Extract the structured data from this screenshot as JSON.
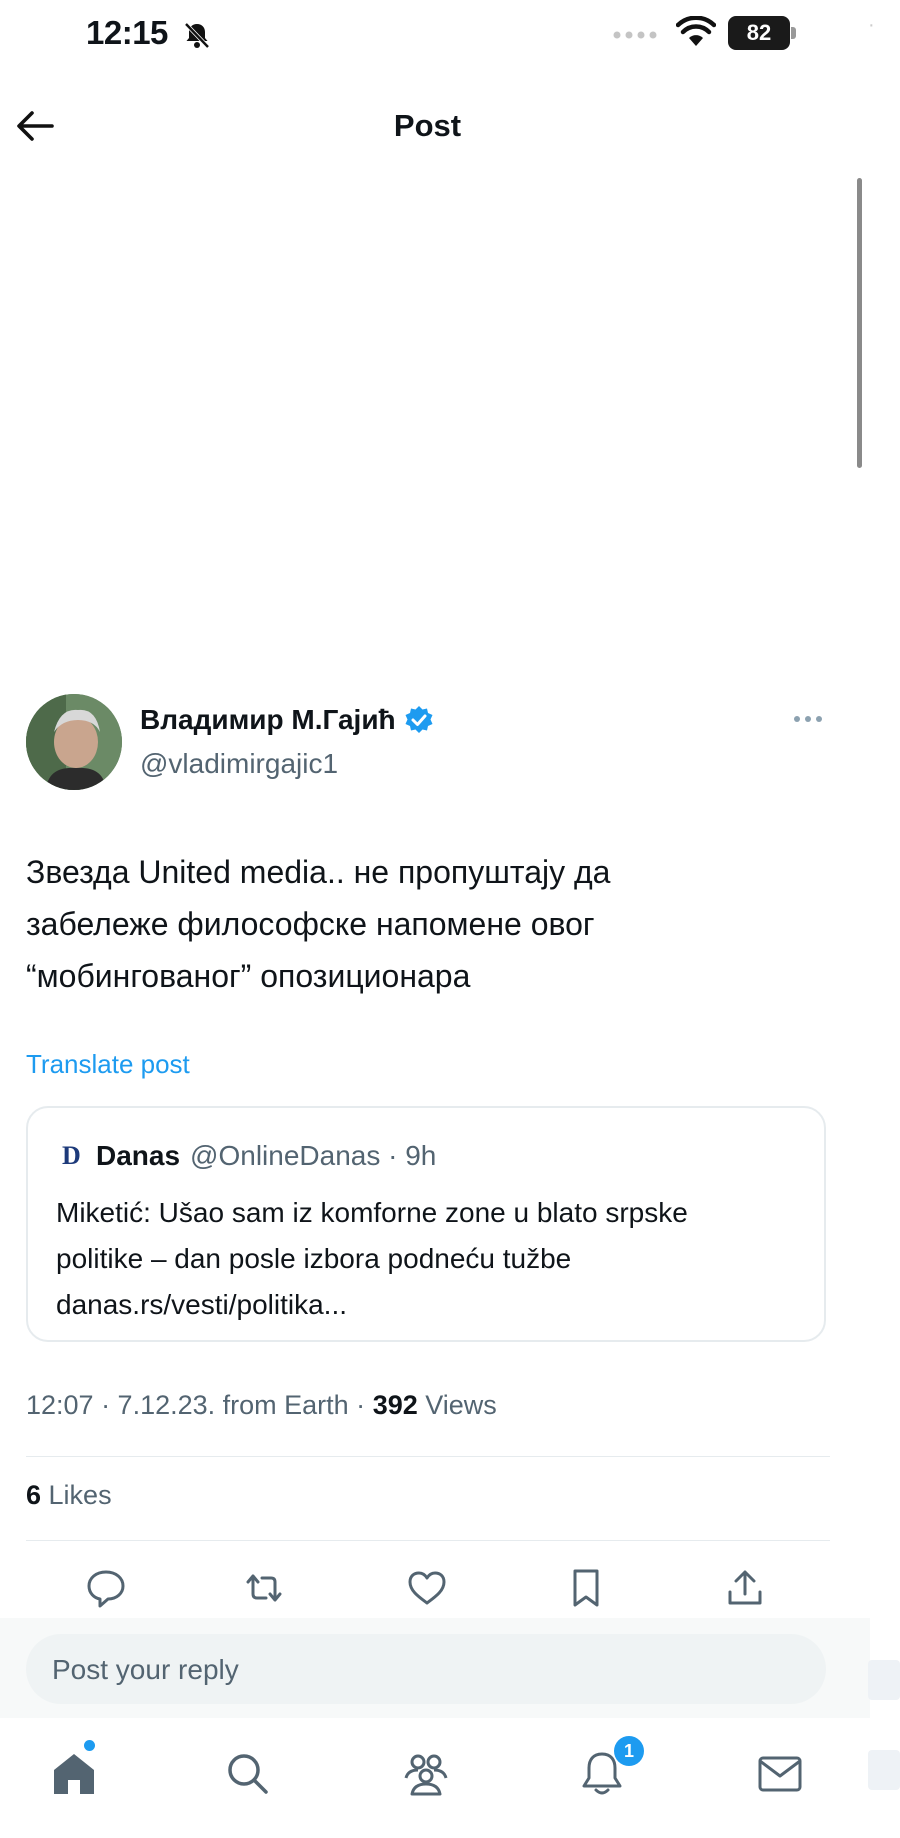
{
  "status_bar": {
    "time": "12:15",
    "battery": "82"
  },
  "header": {
    "title": "Post"
  },
  "post": {
    "author_name": "Владимир М.Гајић",
    "author_handle": "@vladimirgajic1",
    "text_lines": [
      "Звезда United media.. не пропуштају да",
      "забележе философске напомене овог",
      "“мобингованог” опозиционара"
    ],
    "translate_label": "Translate post",
    "quote": {
      "logo_letter": "D",
      "name": "Danas",
      "meta": "@OnlineDanas · 9h",
      "text_lines": [
        "Miketić: Ušao sam iz komforne zone u blato srpske",
        "politike – dan posle izbora podneću tužbe",
        "danas.rs/vesti/politika..."
      ]
    },
    "timestamp_prefix": "12:07 · 7.12.23. from Earth · ",
    "views_count": "392",
    "views_label": " Views",
    "likes_count": "6",
    "likes_label": " Likes"
  },
  "actions": [
    "reply-icon",
    "repost-icon",
    "like-icon",
    "bookmark-icon",
    "share-icon"
  ],
  "reply": {
    "placeholder": "Post your reply"
  },
  "bottom_nav": {
    "items": [
      "home-icon",
      "search-icon",
      "communities-icon",
      "notifications-icon",
      "messages-icon"
    ],
    "notification_count": "1"
  },
  "colors": {
    "accent": "#1d9bf0",
    "text": "#0f1419",
    "secondary": "#536471"
  }
}
